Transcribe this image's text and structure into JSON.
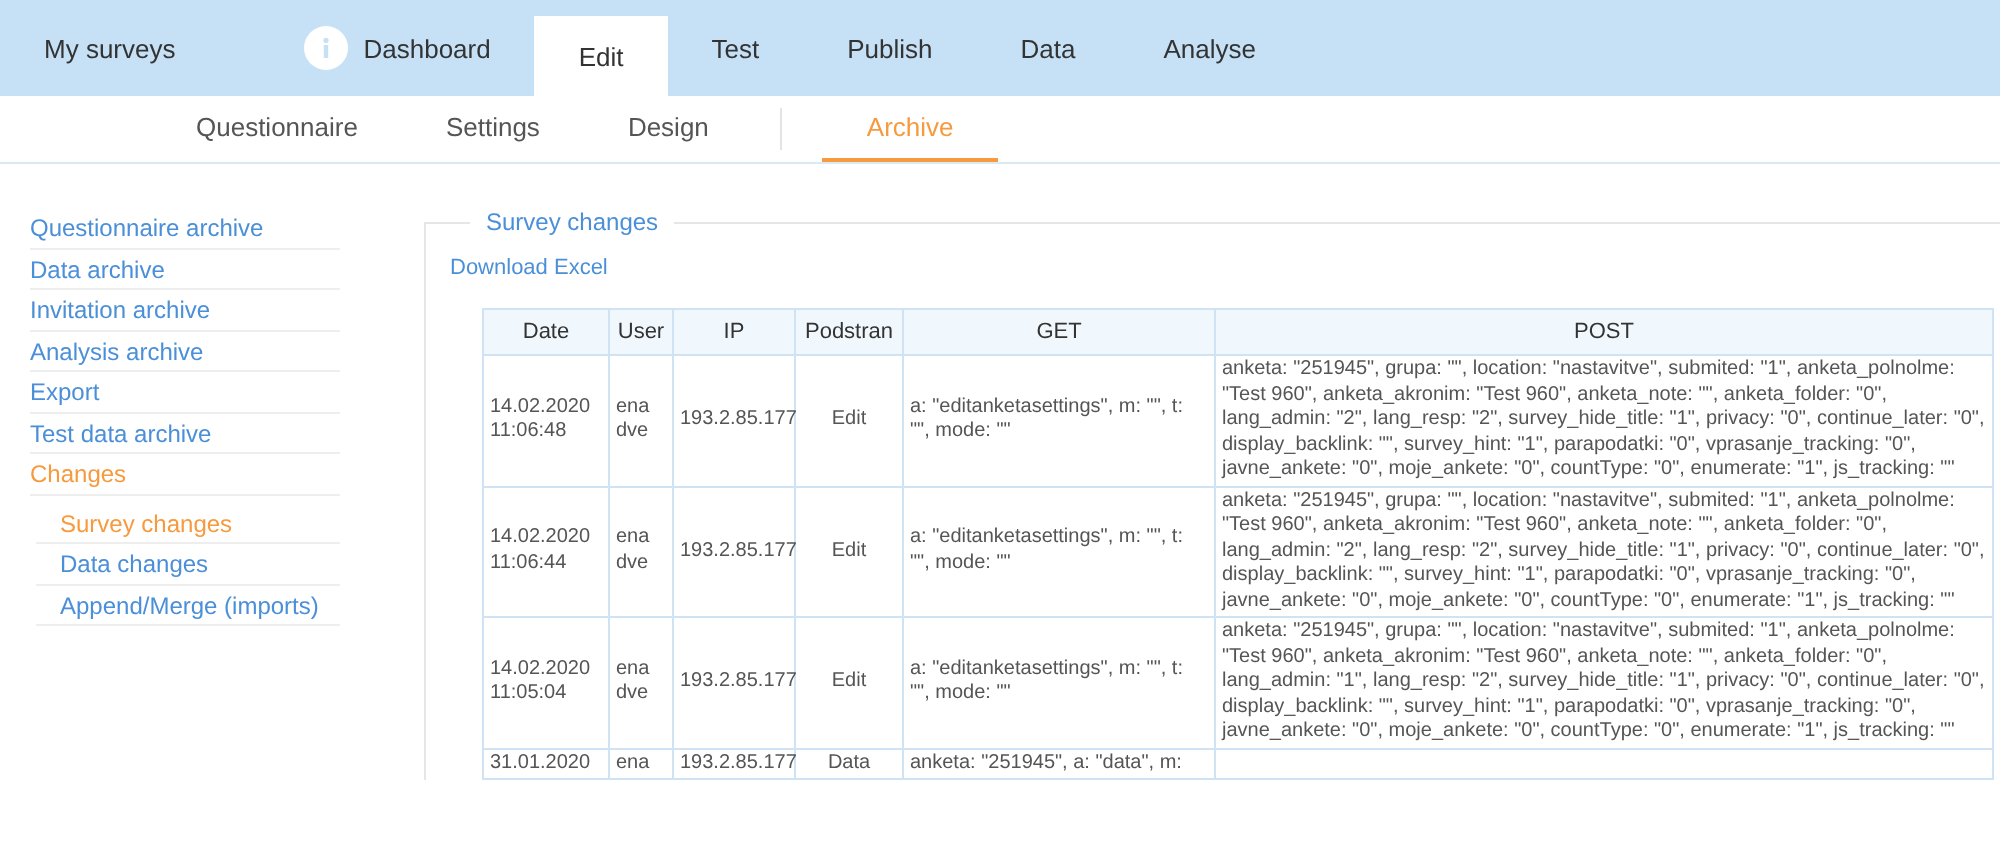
{
  "top_tabs": [
    {
      "label": "My surveys",
      "icon": false,
      "selected": false
    },
    {
      "label": "Dashboard",
      "icon": true,
      "selected": false
    },
    {
      "label": "Edit",
      "icon": false,
      "selected": true
    },
    {
      "label": "Test",
      "icon": false,
      "selected": false
    },
    {
      "label": "Publish",
      "icon": false,
      "selected": false
    },
    {
      "label": "Data",
      "icon": false,
      "selected": false
    },
    {
      "label": "Analyse",
      "icon": false,
      "selected": false
    }
  ],
  "sub_tabs": [
    {
      "label": "Questionnaire",
      "selected": false
    },
    {
      "label": "Settings",
      "selected": false
    },
    {
      "label": "Design",
      "selected": false
    },
    {
      "label": "Archive",
      "selected": true
    }
  ],
  "sidebar": {
    "items": [
      {
        "label": "Questionnaire archive",
        "selected": false
      },
      {
        "label": "Data archive",
        "selected": false
      },
      {
        "label": "Invitation archive",
        "selected": false
      },
      {
        "label": "Analysis archive",
        "selected": false
      },
      {
        "label": "Export",
        "selected": false
      },
      {
        "label": "Test data archive",
        "selected": false
      },
      {
        "label": "Changes",
        "selected": true,
        "children": [
          {
            "label": "Survey changes",
            "selected": true
          },
          {
            "label": "Data changes",
            "selected": false
          },
          {
            "label": "Append/Merge (imports)",
            "selected": false
          }
        ]
      }
    ]
  },
  "panel": {
    "title": "Survey changes",
    "download_link": "Download Excel",
    "table": {
      "columns": [
        "Date",
        "User",
        "IP",
        "Podstran",
        "GET",
        "POST"
      ],
      "rows": [
        [
          "14.02.2020 11:06:48",
          "ena dve",
          "193.2.85.177",
          "Edit",
          "a: \"editanketasettings\", m: \"\", t: \"\", mode: \"\"",
          "anketa: \"251945\", grupa: \"\", location: \"nastavitve\", submited: \"1\", anketa_polnolme: \"Test 960\", anketa_akronim: \"Test 960\", anketa_note: \"\", anketa_folder: \"0\", lang_admin: \"2\", lang_resp: \"2\", survey_hide_title: \"1\", privacy: \"0\", continue_later: \"0\", display_backlink: \"\", survey_hint: \"1\", parapodatki: \"0\", vprasanje_tracking: \"0\", javne_ankete: \"0\", moje_ankete: \"0\", countType: \"0\", enumerate: \"1\", js_tracking: \"\""
        ],
        [
          "14.02.2020 11:06:44",
          "ena dve",
          "193.2.85.177",
          "Edit",
          "a: \"editanketasettings\", m: \"\", t: \"\", mode: \"\"",
          "anketa: \"251945\", grupa: \"\", location: \"nastavitve\", submited: \"1\", anketa_polnolme: \"Test 960\", anketa_akronim: \"Test 960\", anketa_note: \"\", anketa_folder: \"0\", lang_admin: \"2\", lang_resp: \"2\", survey_hide_title: \"1\", privacy: \"0\", continue_later: \"0\", display_backlink: \"\", survey_hint: \"1\", parapodatki: \"0\", vprasanje_tracking: \"0\", javne_ankete: \"0\", moje_ankete: \"0\", countType: \"0\", enumerate: \"1\", js_tracking: \"\""
        ],
        [
          "14.02.2020 11:05:04",
          "ena dve",
          "193.2.85.177",
          "Edit",
          "a: \"editanketasettings\", m: \"\", t: \"\", mode: \"\"",
          "anketa: \"251945\", grupa: \"\", location: \"nastavitve\", submited: \"1\", anketa_polnolme: \"Test 960\", anketa_akronim: \"Test 960\", anketa_note: \"\", anketa_folder: \"0\", lang_admin: \"1\", lang_resp: \"2\", survey_hide_title: \"1\", privacy: \"0\", continue_later: \"0\", display_backlink: \"\", survey_hint: \"1\", parapodatki: \"0\", vprasanje_tracking: \"0\", javne_ankete: \"0\", moje_ankete: \"0\", countType: \"0\", enumerate: \"1\", js_tracking: \"\""
        ],
        [
          "31.01.2020",
          "ena",
          "193.2.85.177",
          "Data",
          "anketa: \"251945\", a: \"data\", m:",
          ""
        ]
      ]
    }
  }
}
